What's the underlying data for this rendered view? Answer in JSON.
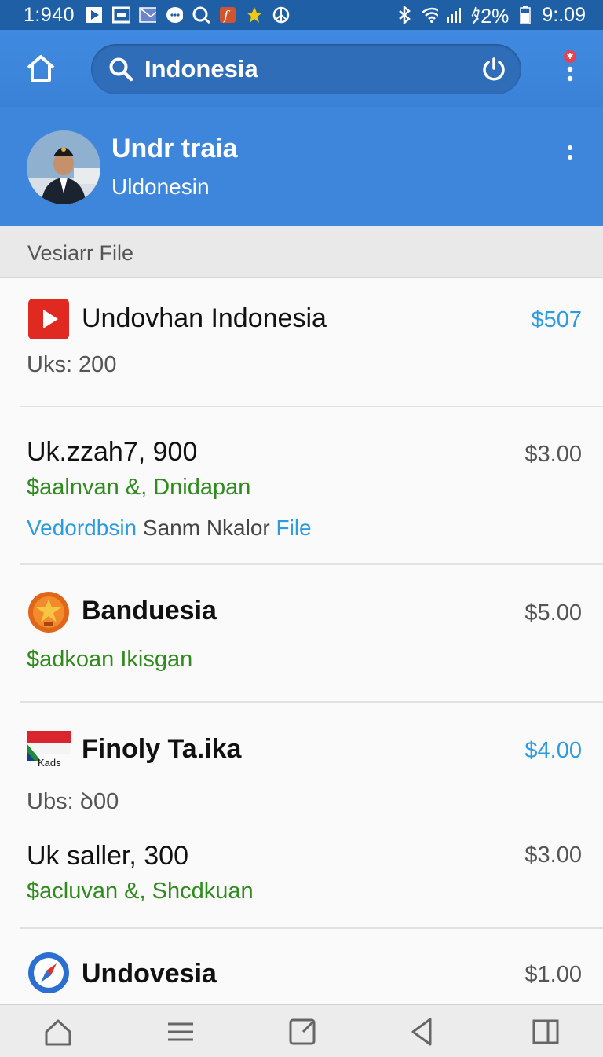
{
  "status": {
    "time_left": "1:940",
    "battery": "ﾀ2%",
    "time_right": "9:.09"
  },
  "search": {
    "query": "Indonesia"
  },
  "profile": {
    "name": "Undr traia",
    "subtitle": "Uldonesin"
  },
  "section": {
    "title": "Vesiarr File"
  },
  "items": [
    {
      "title": "Undovhan Indonesia",
      "price": "$507",
      "meta": "Uks:  200"
    },
    {
      "title": "Uk.zzah7, 900",
      "price": "$3.00",
      "green": "$aalnvan &, Dnidapan",
      "link_a": "Vedordbsin",
      "link_b": " Sanm Nkalor ",
      "link_c": "File"
    },
    {
      "title": "Banduesia",
      "price": "$5.00",
      "green": "$adkoan Ikisgan"
    },
    {
      "title": "Finoly Ta.ika",
      "price": "$4.00",
      "meta": "Ubs:  ꝺ00",
      "badge": "Kads"
    },
    {
      "title": "Uk saller, 300",
      "price": "$3.00",
      "green": "$acluvan &, Shcdkuan"
    },
    {
      "title": "Undovesia",
      "price": "$1.00"
    }
  ]
}
